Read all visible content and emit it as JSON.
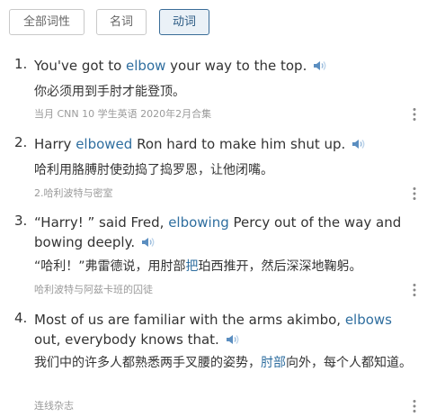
{
  "filters": [
    {
      "label": "全部词性",
      "active": false
    },
    {
      "label": "名词",
      "active": false
    },
    {
      "label": "动词",
      "active": true
    }
  ],
  "entries": [
    {
      "number": "1.",
      "en_before": "You've got to ",
      "en_highlight": "elbow",
      "en_after": " your way to the top.",
      "zh": "你必须用到手肘才能登顶。",
      "source": "当月 CNN 10 学生英语 2020年2月合集"
    },
    {
      "number": "2.",
      "en_before": "Harry ",
      "en_highlight": "elbowed",
      "en_after": " Ron hard to make him shut up.",
      "zh": "哈利用胳膊肘使劲捣了捣罗恩，让他闭嘴。",
      "source": "2.哈利波特与密室"
    },
    {
      "number": "3.",
      "en_before": "“Harry! ” said Fred, ",
      "en_highlight": "elbowing",
      "en_after": " Percy out of the way and bowing deeply.",
      "zh_before": "“哈利！”弗雷德说，用肘部",
      "zh_highlight": "把",
      "zh_after": "珀西推开，然后深深地鞠躬。",
      "source": "哈利波特与阿兹卡班的囚徒"
    },
    {
      "number": "4.",
      "en_before": "Most of us are familiar with the arms akimbo, ",
      "en_highlight": "elbows",
      "en_after": " out, everybody knows that.",
      "zh_before": "我们中的许多人都熟悉两手叉腰的姿势，",
      "zh_highlight": "肘部",
      "zh_after": "向外，每个人都知道。",
      "source": "连线杂志"
    }
  ],
  "colors": {
    "highlight": "#2f6e9f",
    "active_border": "#3a6d98",
    "source_text": "#9a9a9a"
  },
  "icons": {
    "speaker": "speaker-icon",
    "more": "more-vertical-icon"
  }
}
